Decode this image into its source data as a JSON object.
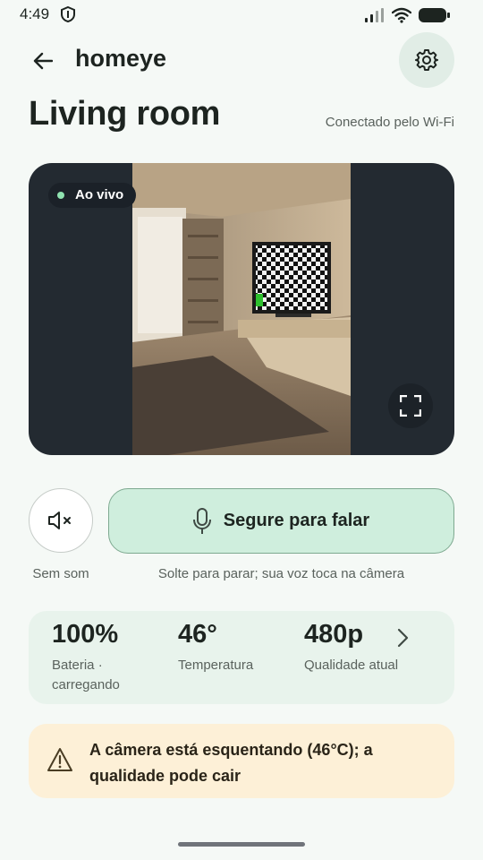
{
  "status_bar": {
    "time": "4:49"
  },
  "header": {
    "app_name": "homeye"
  },
  "room": {
    "name": "Living room",
    "connection": "Conectado pelo Wi-Fi"
  },
  "video": {
    "live_label": "Ao vivo"
  },
  "controls": {
    "mute_label": "Sem som",
    "talk_label": "Segure para falar",
    "talk_hint": "Solte para parar; sua voz toca na câmera"
  },
  "stats": {
    "battery_value": "100%",
    "battery_label": "Bateria · carregando",
    "temperature_value": "46°",
    "temperature_label": "Temperatura",
    "quality_value": "480p",
    "quality_label": "Qualidade atual"
  },
  "warning": {
    "text": "A câmera está esquentando (46°C); a qualidade pode cair"
  },
  "colors": {
    "background": "#f5f9f6",
    "accent": "#cfeedd",
    "live_dot": "#8fe2b0",
    "warning_bg": "#fdf0d7"
  }
}
